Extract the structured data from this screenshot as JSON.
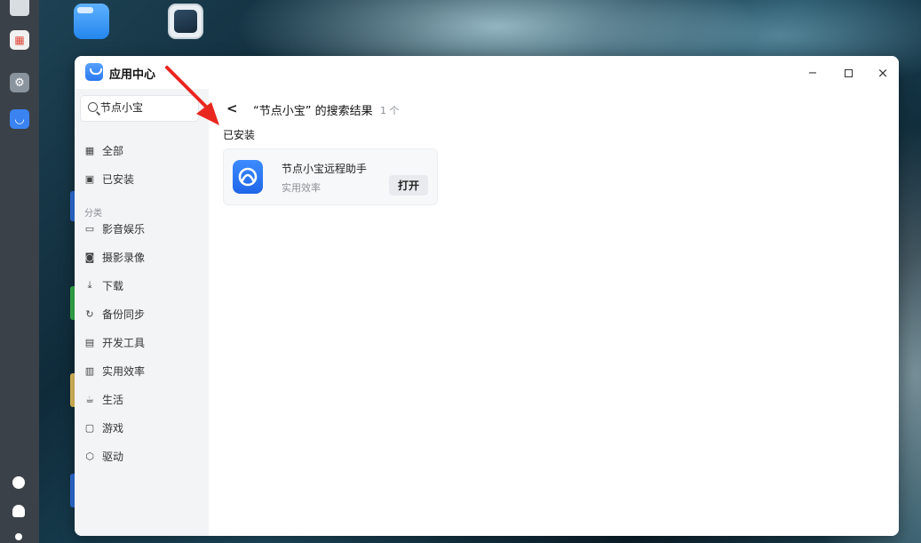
{
  "window": {
    "title": "应用中心",
    "minimize_glyph": "−",
    "close_glyph": "×"
  },
  "sidebar": {
    "search_value": "节点小宝",
    "items_top": [
      {
        "label": "全部",
        "icon": "grid-icon"
      },
      {
        "label": "已安装",
        "icon": "installed-icon"
      }
    ],
    "category_heading": "分类",
    "categories": [
      {
        "label": "影音娱乐",
        "icon": "video-icon"
      },
      {
        "label": "摄影录像",
        "icon": "camera-icon"
      },
      {
        "label": "下载",
        "icon": "download-icon"
      },
      {
        "label": "备份同步",
        "icon": "sync-icon"
      },
      {
        "label": "开发工具",
        "icon": "dev-tools-icon"
      },
      {
        "label": "实用效率",
        "icon": "utility-icon"
      },
      {
        "label": "生活",
        "icon": "life-icon"
      },
      {
        "label": "游戏",
        "icon": "game-icon"
      },
      {
        "label": "驱动",
        "icon": "driver-icon"
      }
    ]
  },
  "main": {
    "back_glyph": "<",
    "result_title": "“节点小宝” 的搜索结果",
    "result_count": "1 个",
    "installed_heading": "已安装",
    "app": {
      "name": "节点小宝远程助手",
      "category": "实用效率",
      "open_label": "打开"
    }
  },
  "colors": {
    "accent": "#2a78f0",
    "annotation_arrow": "#e8271f"
  }
}
